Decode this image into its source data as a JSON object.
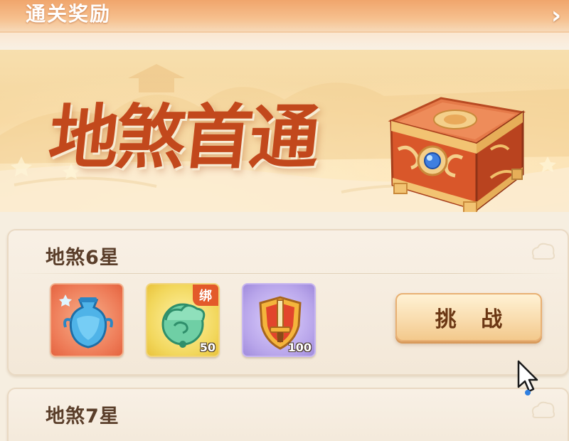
{
  "header": {
    "title": "通关奖励",
    "close_glyph": "›"
  },
  "banner": {
    "title": "地煞首通",
    "chest_icon": "treasure-chest-icon"
  },
  "rewards": [
    {
      "title": "地煞6星",
      "items": [
        {
          "icon": "blue-vase-icon",
          "count": "",
          "tag": ""
        },
        {
          "icon": "jade-cloud-icon",
          "count": "50",
          "tag": "绑"
        },
        {
          "icon": "shield-sword-icon",
          "count": "100",
          "tag": ""
        }
      ],
      "action_label": "挑 战"
    },
    {
      "title": "地煞7星"
    }
  ],
  "colors": {
    "header_orange": "#f0a56c",
    "title_red": "#c2481c",
    "card_bg": "#f8f0e5",
    "button_gold": "#f9dcae",
    "bind_tag": "#e35a2a"
  }
}
